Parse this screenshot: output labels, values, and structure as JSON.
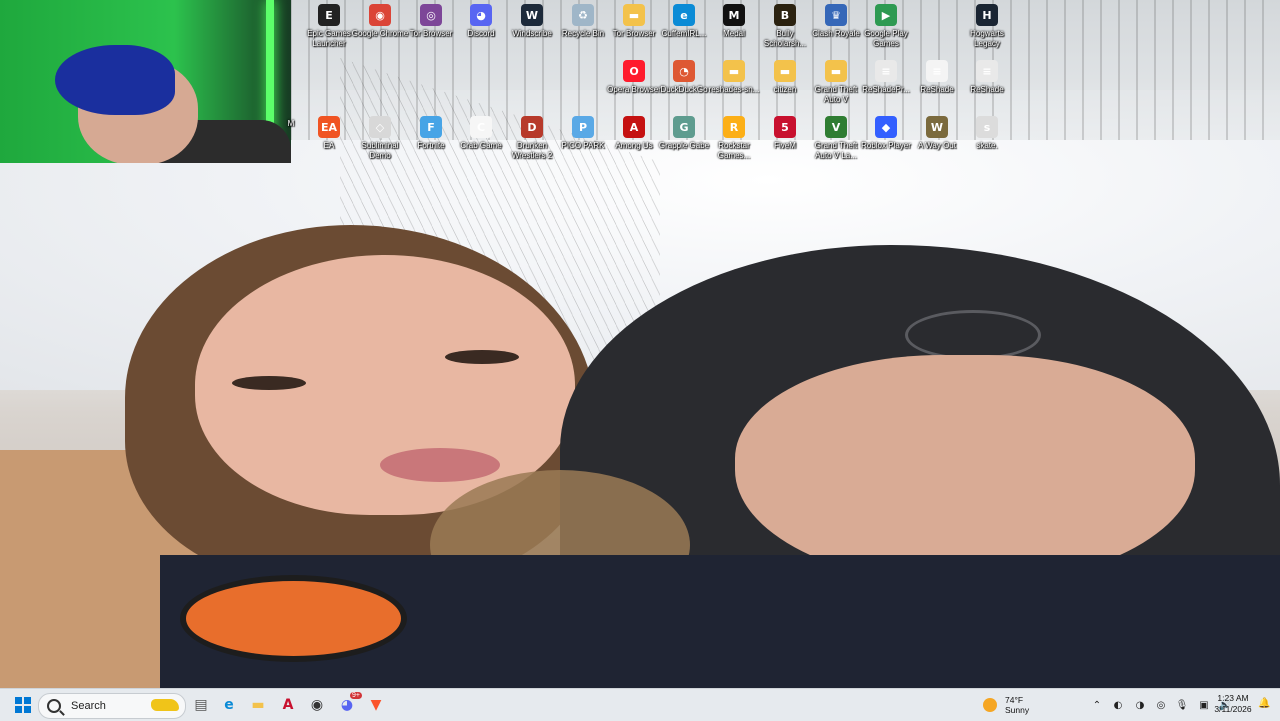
{
  "desktop": {
    "icons": [
      {
        "label": "Epic Games Launcher",
        "icon": "epic-games-icon",
        "color": "#222222",
        "glyph": "E"
      },
      {
        "label": "Google Chrome",
        "icon": "chrome-icon",
        "color": "#db4437",
        "glyph": "◉"
      },
      {
        "label": "Tor Browser",
        "icon": "tor-icon",
        "color": "#7d4698",
        "glyph": "◎"
      },
      {
        "label": "Discord",
        "icon": "discord-icon",
        "color": "#5865f2",
        "glyph": "◕"
      },
      {
        "label": "Windscribe",
        "icon": "windscribe-icon",
        "color": "#1d2a3a",
        "glyph": "W"
      },
      {
        "label": "Recycle Bin",
        "icon": "recycle-bin-icon",
        "color": "#9fb6c8",
        "glyph": "♻"
      },
      {
        "label": "Tor Browser",
        "icon": "folder-icon",
        "color": "#f3c24b",
        "glyph": "▬"
      },
      {
        "label": "CuffemIRL...",
        "icon": "edge-icon",
        "color": "#0b8bd6",
        "glyph": "e"
      },
      {
        "label": "Medal",
        "icon": "medal-icon",
        "color": "#111111",
        "glyph": "M"
      },
      {
        "label": "Bully Scholarsh...",
        "icon": "bully-icon",
        "color": "#2b2210",
        "glyph": "B"
      },
      {
        "label": "Clash Royale",
        "icon": "clash-royale-icon",
        "color": "#3567b8",
        "glyph": "♛"
      },
      {
        "label": "Google Play Games",
        "icon": "google-play-games-icon",
        "color": "#2e9a52",
        "glyph": "▶"
      },
      {
        "label": "Hogwarts Legacy",
        "icon": "hogwarts-legacy-icon",
        "color": "#1a2533",
        "glyph": "H"
      },
      {
        "label": "Opera Browser",
        "icon": "opera-icon",
        "color": "#ff1b2d",
        "glyph": "O"
      },
      {
        "label": "DuckDuckGo",
        "icon": "duckduckgo-icon",
        "color": "#de5833",
        "glyph": "◔"
      },
      {
        "label": "reshades-sn...",
        "icon": "folder-icon",
        "color": "#f3c24b",
        "glyph": "▬"
      },
      {
        "label": "citizen",
        "icon": "folder-icon",
        "color": "#f3c24b",
        "glyph": "▬"
      },
      {
        "label": "Grand Theft Auto V",
        "icon": "folder-icon",
        "color": "#f3c24b",
        "glyph": "▬"
      },
      {
        "label": "ReShadePr...",
        "icon": "file-icon",
        "color": "#e9e9e9",
        "glyph": "≡"
      },
      {
        "label": "ReShade",
        "icon": "file-icon",
        "color": "#f4f4f4",
        "glyph": "≡"
      },
      {
        "label": "ReShade",
        "icon": "file-icon",
        "color": "#e9e9e9",
        "glyph": "≡"
      },
      {
        "label": "EA",
        "icon": "ea-icon",
        "color": "#f05423",
        "glyph": "EA"
      },
      {
        "label": "Subliminal Demo",
        "icon": "subliminal-icon",
        "color": "#d8d8d8",
        "glyph": "◇"
      },
      {
        "label": "Fortnite",
        "icon": "fortnite-icon",
        "color": "#47a4e6",
        "glyph": "F"
      },
      {
        "label": "Crab Game",
        "icon": "crab-game-icon",
        "color": "#f6f6f6",
        "glyph": "C"
      },
      {
        "label": "Drunken Wrestlers 2",
        "icon": "drunken-wrestlers-icon",
        "color": "#b73a2b",
        "glyph": "D"
      },
      {
        "label": "PICO PARK",
        "icon": "pico-park-icon",
        "color": "#5aa9e6",
        "glyph": "P"
      },
      {
        "label": "Among Us",
        "icon": "among-us-icon",
        "color": "#c51111",
        "glyph": "A"
      },
      {
        "label": "Grapple Gabe",
        "icon": "grapple-gabe-icon",
        "color": "#5e9c8f",
        "glyph": "G"
      },
      {
        "label": "Rockstar Games...",
        "icon": "rockstar-icon",
        "color": "#fcaf17",
        "glyph": "R"
      },
      {
        "label": "FiveM",
        "icon": "fivem-icon",
        "color": "#c8102e",
        "glyph": "5"
      },
      {
        "label": "Grand Theft Auto V La...",
        "icon": "gta-v-icon",
        "color": "#2f7d32",
        "glyph": "V"
      },
      {
        "label": "Roblox Player",
        "icon": "roblox-icon",
        "color": "#335fff",
        "glyph": "◆"
      },
      {
        "label": "A Way Out",
        "icon": "a-way-out-icon",
        "color": "#7b6a3d",
        "glyph": "W"
      },
      {
        "label": "skate.",
        "icon": "skate-icon",
        "color": "#dcdcdc",
        "glyph": "s"
      }
    ],
    "partial_label": "M"
  },
  "taskbar": {
    "search_label": "Search",
    "apps": [
      {
        "icon": "file-explorer-icon",
        "glyph": "▤",
        "color": "#555555"
      },
      {
        "icon": "edge-icon",
        "glyph": "e",
        "color": "#0b8bd6"
      },
      {
        "icon": "folder-icon",
        "glyph": "▬",
        "color": "#f3c24b"
      },
      {
        "icon": "app-a-icon",
        "glyph": "A",
        "color": "#c8102e"
      },
      {
        "icon": "obs-icon",
        "glyph": "◉",
        "color": "#333333"
      },
      {
        "icon": "discord-icon",
        "glyph": "◕",
        "color": "#5865f2"
      },
      {
        "icon": "brave-icon",
        "glyph": "▼",
        "color": "#fb542b"
      }
    ],
    "discord_badge": "9+",
    "weather": {
      "temp": "74°F",
      "condition": "Sunny"
    },
    "tray": [
      {
        "icon": "chevron-up-icon",
        "glyph": "⌃"
      },
      {
        "icon": "norton-icon",
        "glyph": "◐"
      },
      {
        "icon": "defender-icon",
        "glyph": "◑"
      },
      {
        "icon": "security-icon",
        "glyph": "◎"
      },
      {
        "icon": "microphone-icon",
        "glyph": "🎙"
      },
      {
        "icon": "network-icon",
        "glyph": "▣"
      },
      {
        "icon": "volume-icon",
        "glyph": "🔊"
      },
      {
        "icon": "battery-icon",
        "glyph": "▭"
      }
    ],
    "clock": {
      "time": "1:23 AM",
      "date": "3/11/2026"
    },
    "notification_icon": "bell-icon"
  }
}
